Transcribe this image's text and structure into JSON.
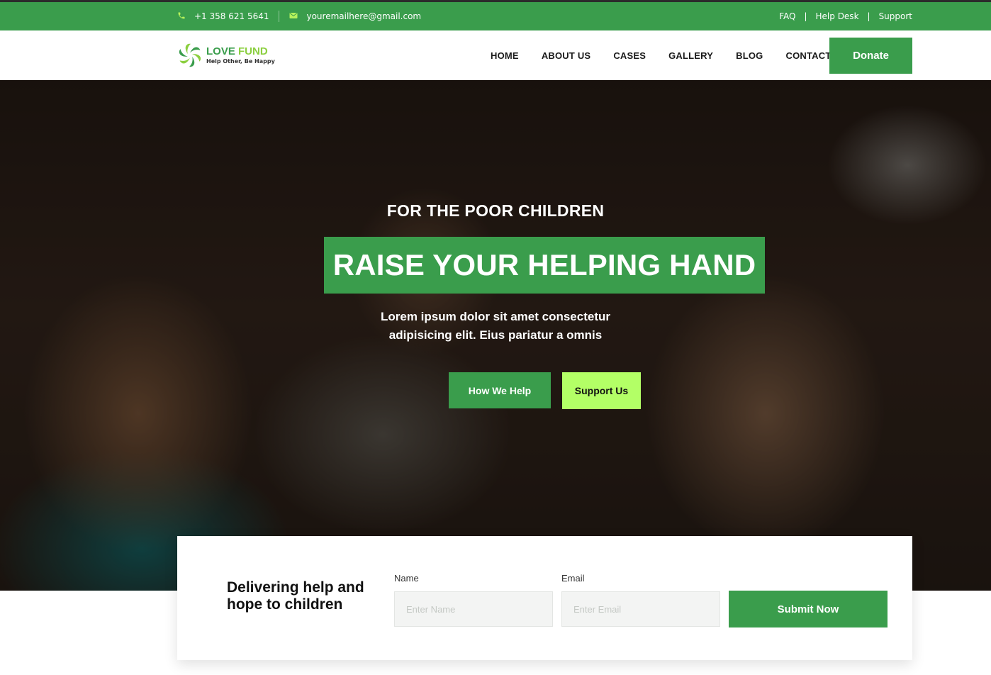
{
  "topbar": {
    "phone": "+1 358 621 5641",
    "email": "youremailhere@gmail.com",
    "links": [
      "FAQ",
      "Help Desk",
      "Support"
    ]
  },
  "brand": {
    "name_part1": "LOVE",
    "name_part2": "FUND",
    "tagline": "Help Other, Be Happy"
  },
  "nav": {
    "items": [
      "HOME",
      "ABOUT US",
      "CASES",
      "GALLERY",
      "BLOG",
      "CONTACT"
    ],
    "donate_label": "Donate"
  },
  "hero": {
    "eyebrow": "FOR THE POOR CHILDREN",
    "headline": "RAISE YOUR HELPING HAND",
    "lead_line1": "Lorem ipsum dolor sit amet consectetur",
    "lead_line2": "adipisicing elit. Eius pariatur a omnis",
    "primary_button": "How We Help",
    "secondary_button": "Support Us"
  },
  "form": {
    "title": "Delivering help and hope to children",
    "name_label": "Name",
    "name_placeholder": "Enter Name",
    "email_label": "Email",
    "email_placeholder": "Enter Email",
    "submit_label": "Submit Now"
  },
  "colors": {
    "primary_green": "#3a9d4c",
    "lime": "#b3ff66"
  },
  "icons": {
    "phone": "phone-icon",
    "email": "envelope-icon",
    "logo": "logo-swirl-icon"
  }
}
